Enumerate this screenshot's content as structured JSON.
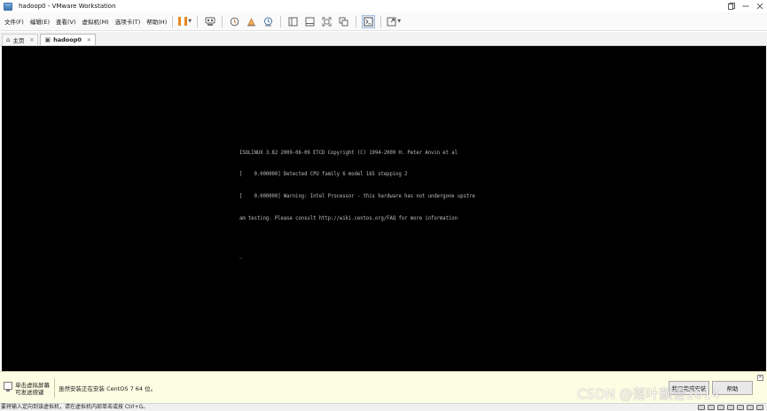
{
  "window": {
    "title": "hadoop0 - VMware Workstation",
    "controls": [
      "restore-icon",
      "minimize-icon",
      "close-icon"
    ]
  },
  "menu": {
    "items": [
      "文件(F)",
      "编辑(E)",
      "查看(V)",
      "虚拟机(M)",
      "选项卡(T)",
      "帮助(H)"
    ]
  },
  "toolbar": {
    "icons": [
      "pause-icon",
      "send-ctrl-alt-del-icon",
      "snapshot-icon",
      "revert-snapshot-icon",
      "snapshot-manager-icon",
      "library-view-icon",
      "thumbnail-view-icon",
      "fullscreen-icon",
      "unity-icon",
      "console-view-icon",
      "stretch-guest-icon"
    ],
    "accent": "#e8871e"
  },
  "tabs": [
    {
      "label": "主页",
      "icon": "home-icon",
      "active": false
    },
    {
      "label": "hadoop0",
      "icon": "vm-icon",
      "active": true
    }
  ],
  "console": {
    "lines": [
      "ISOLINUX 3.82 2009-06-09 ETCD Copyright (C) 1994-2009 H. Peter Anvin et al",
      "[    0.000000] Detected CPU family 6 model 165 stepping 2",
      "[    0.000000] Warning: Intel Processor - this hardware has not undergone upstre",
      "am testing. Please consult http://wiki.centos.org/FAQ for more information",
      "",
      "_"
    ],
    "background": "#000000"
  },
  "notification": {
    "hint_line1": "单击虚拟屏幕",
    "hint_line2": "可发送按键",
    "message": "虽然安装正在安装 CentOS 7 64 位。",
    "done_button": "我已完成安装",
    "help_button": "帮助"
  },
  "status": {
    "text": "要将输入定向到该虚拟机，请在虚拟机内部单击或按 Ctrl+G。"
  },
  "watermark": {
    "text": "CSDN @落叶飘雪2014"
  }
}
